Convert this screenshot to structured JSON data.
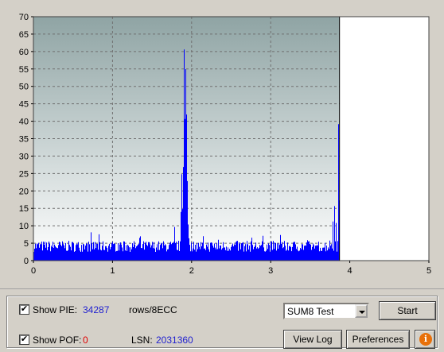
{
  "chart_data": {
    "type": "bar",
    "title": "",
    "xlabel": "",
    "ylabel": "",
    "xlim": [
      0,
      5
    ],
    "ylim": [
      0,
      70
    ],
    "x_ticks": [
      "0",
      "1",
      "2",
      "3",
      "4",
      "5"
    ],
    "y_ticks": [
      "0",
      "5",
      "10",
      "15",
      "20",
      "25",
      "30",
      "35",
      "40",
      "45",
      "50",
      "55",
      "60",
      "65",
      "70"
    ],
    "grid": true,
    "marker_x": 3.87,
    "series": [
      {
        "color": "#0000ff",
        "peaks": [
          {
            "x": 1.78,
            "y": 10
          },
          {
            "x": 1.88,
            "y": 11
          },
          {
            "x": 1.89,
            "y": 30
          },
          {
            "x": 1.9,
            "y": 65
          },
          {
            "x": 1.91,
            "y": 45
          },
          {
            "x": 1.92,
            "y": 61
          },
          {
            "x": 1.93,
            "y": 45
          },
          {
            "x": 1.94,
            "y": 25
          },
          {
            "x": 1.96,
            "y": 8
          },
          {
            "x": 3.8,
            "y": 17
          },
          {
            "x": 3.82,
            "y": 13
          },
          {
            "x": 3.85,
            "y": 40
          },
          {
            "x": 3.86,
            "y": 22
          },
          {
            "x": 3.87,
            "y": 15
          }
        ],
        "baseline": "3-6 per sample",
        "data_end_x": 3.87
      }
    ]
  },
  "colors": {
    "plot_top": "#8fa4a4",
    "plot_bottom": "#ffffff",
    "bar": "#0000ff",
    "panel": "#d4d0c8"
  },
  "controls": {
    "show_pie_label": "Show PIE:",
    "pie_value": "34287",
    "pie_unit": "rows/8ECC",
    "show_pof_label": "Show POF:",
    "pof_value": "0",
    "lsn_label": "LSN:",
    "lsn_value": "2031360",
    "test_select": "SUM8 Test",
    "start_button": "Start",
    "view_log_button": "View Log",
    "preferences_button": "Preferences",
    "info_icon": "info-icon",
    "checkmark": "✔"
  }
}
